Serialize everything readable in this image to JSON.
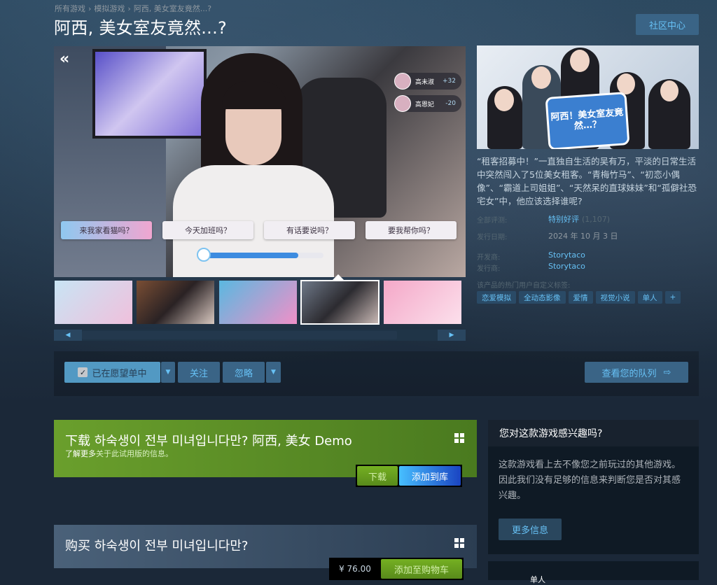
{
  "breadcrumb": [
    "所有游戏",
    "模拟游戏",
    "阿西, 美女室友竟然...?"
  ],
  "page_title": "阿西, 美女室友竟然...?",
  "community_hub_label": "社区中心",
  "video": {
    "choices": [
      "来我家看猫吗？",
      "今天加班吗？",
      "有话要说吗？",
      "要我帮你吗？"
    ],
    "affection": [
      {
        "name": "高未淑",
        "value": "+32"
      },
      {
        "name": "高恩妃",
        "value": "-20"
      }
    ],
    "progress_fraction": 0.8
  },
  "capsule_logo": "阿西！美女室友竟然…？",
  "description": "“租客招募中！”一直独自生活的吴有万，平淡的日常生活中突然闯入了5位美女租客。“青梅竹马”、“初恋小偶像”、“霸道上司姐姐”、“天然呆的直球妹妹”和“孤僻社恐宅女”中，他应该选择谁呢?",
  "meta": {
    "reviews_label": "全部评测:",
    "reviews_value": "特别好评",
    "reviews_count": "(1,107)",
    "release_label": "发行日期:",
    "release_value": "2024 年 10 月 3 日",
    "developer_label": "开发商:",
    "developer_value": "Storytaco",
    "publisher_label": "发行商:",
    "publisher_value": "Storytaco"
  },
  "tags_title": "该产品的热门用户自定义标签:",
  "tags": [
    "恋爱模拟",
    "全动态影像",
    "爱情",
    "视觉小说",
    "单人",
    "+"
  ],
  "actions": {
    "wishlist": "已在愿望单中",
    "follow": "关注",
    "ignore": "忽略",
    "queue": "查看您的队列"
  },
  "demo": {
    "title": "下载 하숙생이 전부 미녀입니다만? 阿西, 美女 Demo",
    "subtitle_link": "了解更多",
    "subtitle_rest": "关于此试用版的信息。",
    "download": "下载",
    "add_library": "添加到库"
  },
  "buy": {
    "title": "购买 하숙생이 전부 미녀입니다만?",
    "price": "¥ 76.00",
    "add_cart": "添加至购物车"
  },
  "interest": {
    "title": "您对这款游戏感兴趣吗?",
    "body": "这款游戏看上去不像您之前玩过的其他游戏。因此我们没有足够的信息来判断您是否对其感兴趣。",
    "more": "更多信息"
  },
  "side_panel2_label": "单人",
  "colors": {
    "accent": "#66c0f4",
    "green": "#75b022",
    "bg": "#1b2838"
  }
}
